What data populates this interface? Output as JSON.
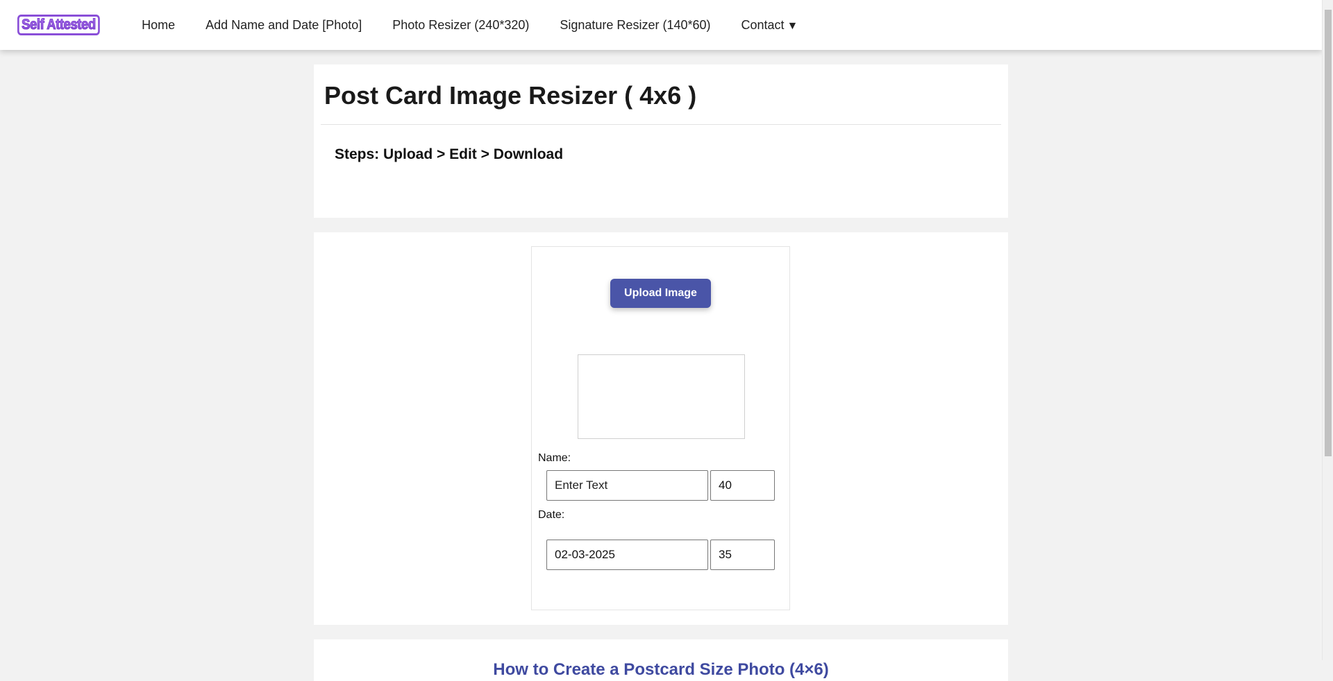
{
  "navbar": {
    "logo_text": "Self Attested",
    "links": [
      {
        "label": "Home"
      },
      {
        "label": "Add Name and Date [Photo]"
      },
      {
        "label": "Photo Resizer (240*320)"
      },
      {
        "label": "Signature Resizer (140*60)"
      },
      {
        "label": "Contact"
      }
    ],
    "contact_caret": "▼"
  },
  "header": {
    "title": "Post Card Image Resizer ( 4x6 )",
    "steps": "Steps: Upload > Edit > Download"
  },
  "editor": {
    "upload_button": "Upload Image",
    "name_label": "Name:",
    "name_placeholder": "Enter Text",
    "name_size": "40",
    "date_label": "Date:",
    "date_value": "02-03-2025",
    "date_size": "35"
  },
  "howto": {
    "title": "How to Create a Postcard Size Photo (4×6)"
  },
  "colors": {
    "accent": "#4a55a8",
    "logo": "#8a4fd8",
    "background": "#f2f2f2"
  }
}
